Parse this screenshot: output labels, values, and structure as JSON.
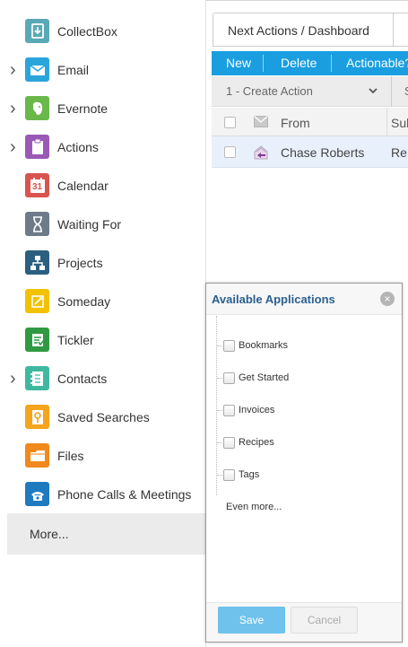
{
  "sidebar": {
    "items": [
      {
        "label": "CollectBox",
        "icon": "collectbox-icon",
        "color": "#5aa9b6",
        "expandable": false
      },
      {
        "label": "Email",
        "icon": "email-icon",
        "color": "#2aa5dc",
        "expandable": true
      },
      {
        "label": "Evernote",
        "icon": "evernote-icon",
        "color": "#6ab84a",
        "expandable": true
      },
      {
        "label": "Actions",
        "icon": "actions-icon",
        "color": "#9b59b6",
        "expandable": true
      },
      {
        "label": "Calendar",
        "icon": "calendar-icon",
        "color": "#d9534f",
        "expandable": false,
        "glyph": "31"
      },
      {
        "label": "Waiting For",
        "icon": "hourglass-icon",
        "color": "#6c7a89",
        "expandable": false
      },
      {
        "label": "Projects",
        "icon": "projects-icon",
        "color": "#2b5f80",
        "expandable": false
      },
      {
        "label": "Someday",
        "icon": "someday-icon",
        "color": "#f2c200",
        "expandable": false
      },
      {
        "label": "Tickler",
        "icon": "tickler-icon",
        "color": "#2f9a43",
        "expandable": false
      },
      {
        "label": "Contacts",
        "icon": "contacts-icon",
        "color": "#3fb8a0",
        "expandable": true
      },
      {
        "label": "Saved Searches",
        "icon": "saved-searches-icon",
        "color": "#f4a41d",
        "expandable": false
      },
      {
        "label": "Files",
        "icon": "files-icon",
        "color": "#f08a1c",
        "expandable": false
      },
      {
        "label": "Phone Calls & Meetings",
        "icon": "phone-icon",
        "color": "#1f7ac0",
        "expandable": false
      }
    ],
    "more_label": "More..."
  },
  "main": {
    "tab_title": "Next Actions / Dashboard",
    "toolbar": {
      "new_label": "New",
      "delete_label": "Delete",
      "actionable_label": "Actionable?"
    },
    "action_select": {
      "value": "1 - Create Action",
      "partial": "S"
    },
    "table": {
      "columns": {
        "from": "From",
        "subject": "Sub"
      },
      "rows": [
        {
          "from": "Chase Roberts",
          "subject": "Re:"
        }
      ]
    }
  },
  "popup": {
    "title": "Available Applications",
    "items": [
      "Bookmarks",
      "Get Started",
      "Invoices",
      "Recipes",
      "Tags"
    ],
    "more_label": "Even more...",
    "save_label": "Save",
    "cancel_label": "Cancel"
  },
  "colors": {
    "accent": "#1a9ee0",
    "popup_title": "#2a5f8f",
    "save_button": "#6fc2ec",
    "selected_row": "#e8f1fb"
  }
}
